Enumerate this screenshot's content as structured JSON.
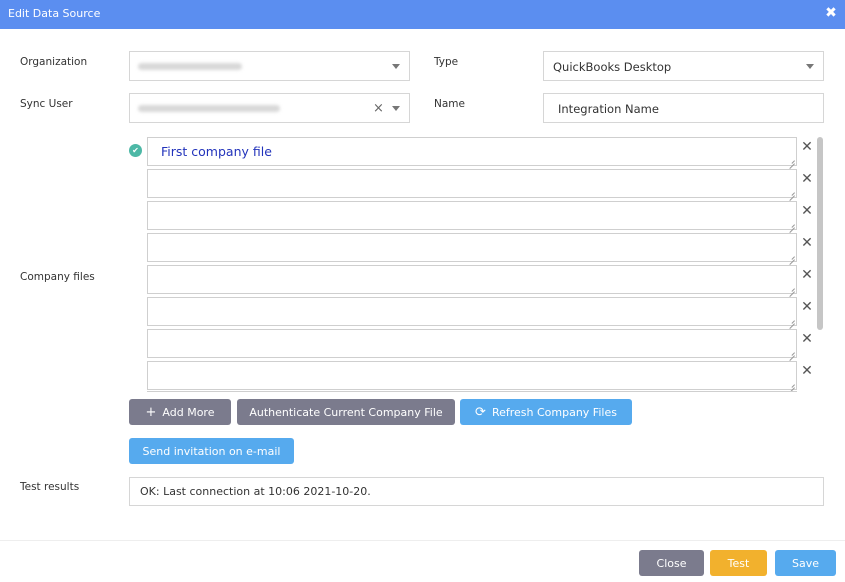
{
  "dialog": {
    "title": "Edit Data Source"
  },
  "form": {
    "organization_label": "Organization",
    "sync_user_label": "Sync User",
    "type_label": "Type",
    "type_value": "QuickBooks Desktop",
    "name_label": "Name",
    "name_value": "Integration Name",
    "company_files_label": "Company files",
    "company_files": [
      "First company file",
      "",
      "",
      "",
      "",
      "",
      "",
      ""
    ],
    "test_results_label": "Test results",
    "test_results_value": "OK: Last connection at 10:06 2021-10-20."
  },
  "buttons": {
    "add_more": "Add More",
    "authenticate": "Authenticate Current Company File",
    "refresh": "Refresh Company Files",
    "send_invitation": "Send invitation on e-mail",
    "close": "Close",
    "test": "Test",
    "save": "Save"
  },
  "icons": {
    "dialog_close": "close-icon",
    "row_remove": "close-icon",
    "add": "plus-icon",
    "refresh": "refresh-icon",
    "status": "check-circle-icon"
  },
  "colors": {
    "titlebar": "#5b8ef0",
    "gray_button": "#7b7b8d",
    "blue_button": "#56aaee",
    "orange_button": "#f2b12d",
    "status_ok": "#4db8a6"
  }
}
